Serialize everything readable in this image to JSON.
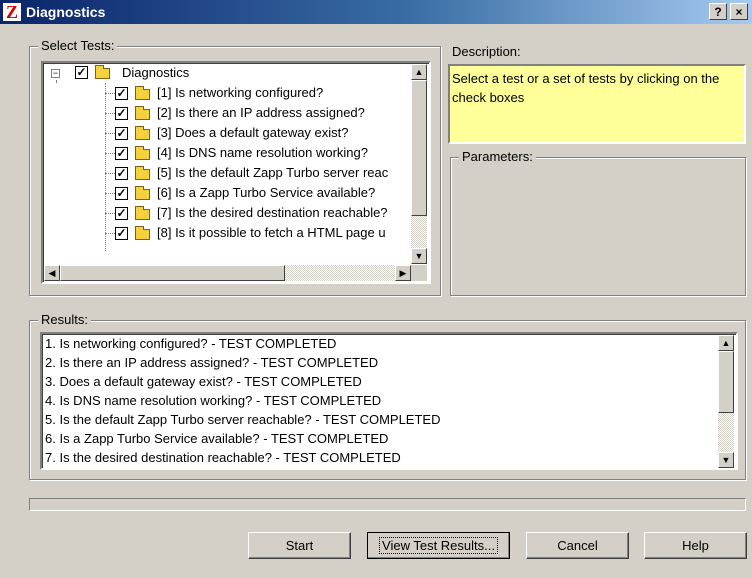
{
  "window": {
    "logo": "Z",
    "title": "Diagnostics",
    "help_glyph": "?",
    "close_glyph": "×"
  },
  "select_tests": {
    "label": "Select Tests:",
    "root": {
      "label": "Diagnostics",
      "expander": "−",
      "checked": true
    },
    "items": [
      {
        "label": "[1] Is networking configured?",
        "checked": true
      },
      {
        "label": "[2] Is there an IP address assigned?",
        "checked": true
      },
      {
        "label": "[3] Does a default gateway exist?",
        "checked": true
      },
      {
        "label": "[4] Is DNS name resolution working?",
        "checked": true
      },
      {
        "label": "[5] Is the default Zapp Turbo server reac",
        "checked": true
      },
      {
        "label": "[6] Is a Zapp Turbo Service available?",
        "checked": true
      },
      {
        "label": "[7] Is the desired destination reachable?",
        "checked": true
      },
      {
        "label": "[8] Is it possible to fetch a HTML page u",
        "checked": true
      }
    ]
  },
  "description": {
    "label": "Description:",
    "text": "Select a test or a set of tests by clicking on the check boxes"
  },
  "parameters": {
    "label": "Parameters:"
  },
  "results": {
    "label": "Results:",
    "lines": [
      "1. Is networking configured? - TEST COMPLETED",
      "2. Is there an IP address assigned? - TEST COMPLETED",
      "3. Does a default gateway exist? - TEST COMPLETED",
      "4. Is DNS name resolution working? - TEST COMPLETED",
      "5. Is the default Zapp Turbo server reachable? - TEST COMPLETED",
      "6. Is a Zapp Turbo Service available? - TEST COMPLETED",
      "7. Is the desired destination reachable? - TEST COMPLETED"
    ]
  },
  "buttons": {
    "start": "Start",
    "view_results": "View Test Results...",
    "cancel": "Cancel",
    "help": "Help"
  },
  "progress": 0,
  "icons": {
    "check": "✓",
    "arrow_up": "▲",
    "arrow_down": "▼",
    "arrow_left": "◀",
    "arrow_right": "▶"
  }
}
